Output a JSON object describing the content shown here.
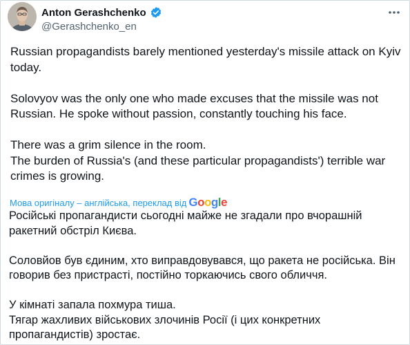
{
  "author": {
    "name": "Anton Gerashchenko",
    "handle": "@Gerashchenko_en",
    "verified": true,
    "avatar_icon": "avatar-icon"
  },
  "tweet": {
    "paragraphs": [
      "Russian propagandists barely mentioned yesterday's missile attack on Kyiv today.",
      "Solovyov was the only one who made excuses that the missile was not Russian. He spoke without passion, constantly touching his face.",
      "There was a grim silence in the room.\nThe burden of Russia's (and these particular propagandists') terrible war crimes is growing."
    ]
  },
  "translation": {
    "source_text": "Мова оригіналу – англійська, переклад від",
    "provider": "Google",
    "paragraphs": [
      "Російські пропагандисти сьогодні майже не згадали про вчорашній ракетний обстріл Києва.",
      "Соловйов був єдиним, хто виправдовувався, що ракета не російська. Він говорив без пристрасті, постійно торкаючись свого обличчя.",
      "У кімнаті запала похмура тиша.\nТягар жахливих військових злочинів Росії (і цих конкретних пропагандистів) зростає."
    ]
  },
  "colors": {
    "verified": "#1d9bf0",
    "link": "#1d9bf0",
    "muted": "#536471",
    "text": "#0f1419"
  }
}
